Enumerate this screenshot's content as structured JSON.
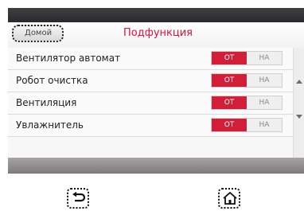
{
  "header": {
    "home_button": "Домой",
    "title": "Подфункция"
  },
  "settings": [
    {
      "label": "Вентилятор автомат",
      "off": "ОТ",
      "on": "НА",
      "value": "ОТ"
    },
    {
      "label": "Робот очистка",
      "off": "ОТ",
      "on": "НА",
      "value": "ОТ"
    },
    {
      "label": "Вентиляция",
      "off": "ОТ",
      "on": "НА",
      "value": "ОТ"
    },
    {
      "label": "Увлажнитель",
      "off": "ОТ",
      "on": "НА",
      "value": "ОТ"
    }
  ],
  "colors": {
    "accent": "#d31e3a",
    "title": "#e0113a"
  },
  "hardware_buttons": {
    "back_icon": "back-arrow-icon",
    "home_icon": "home-icon"
  }
}
